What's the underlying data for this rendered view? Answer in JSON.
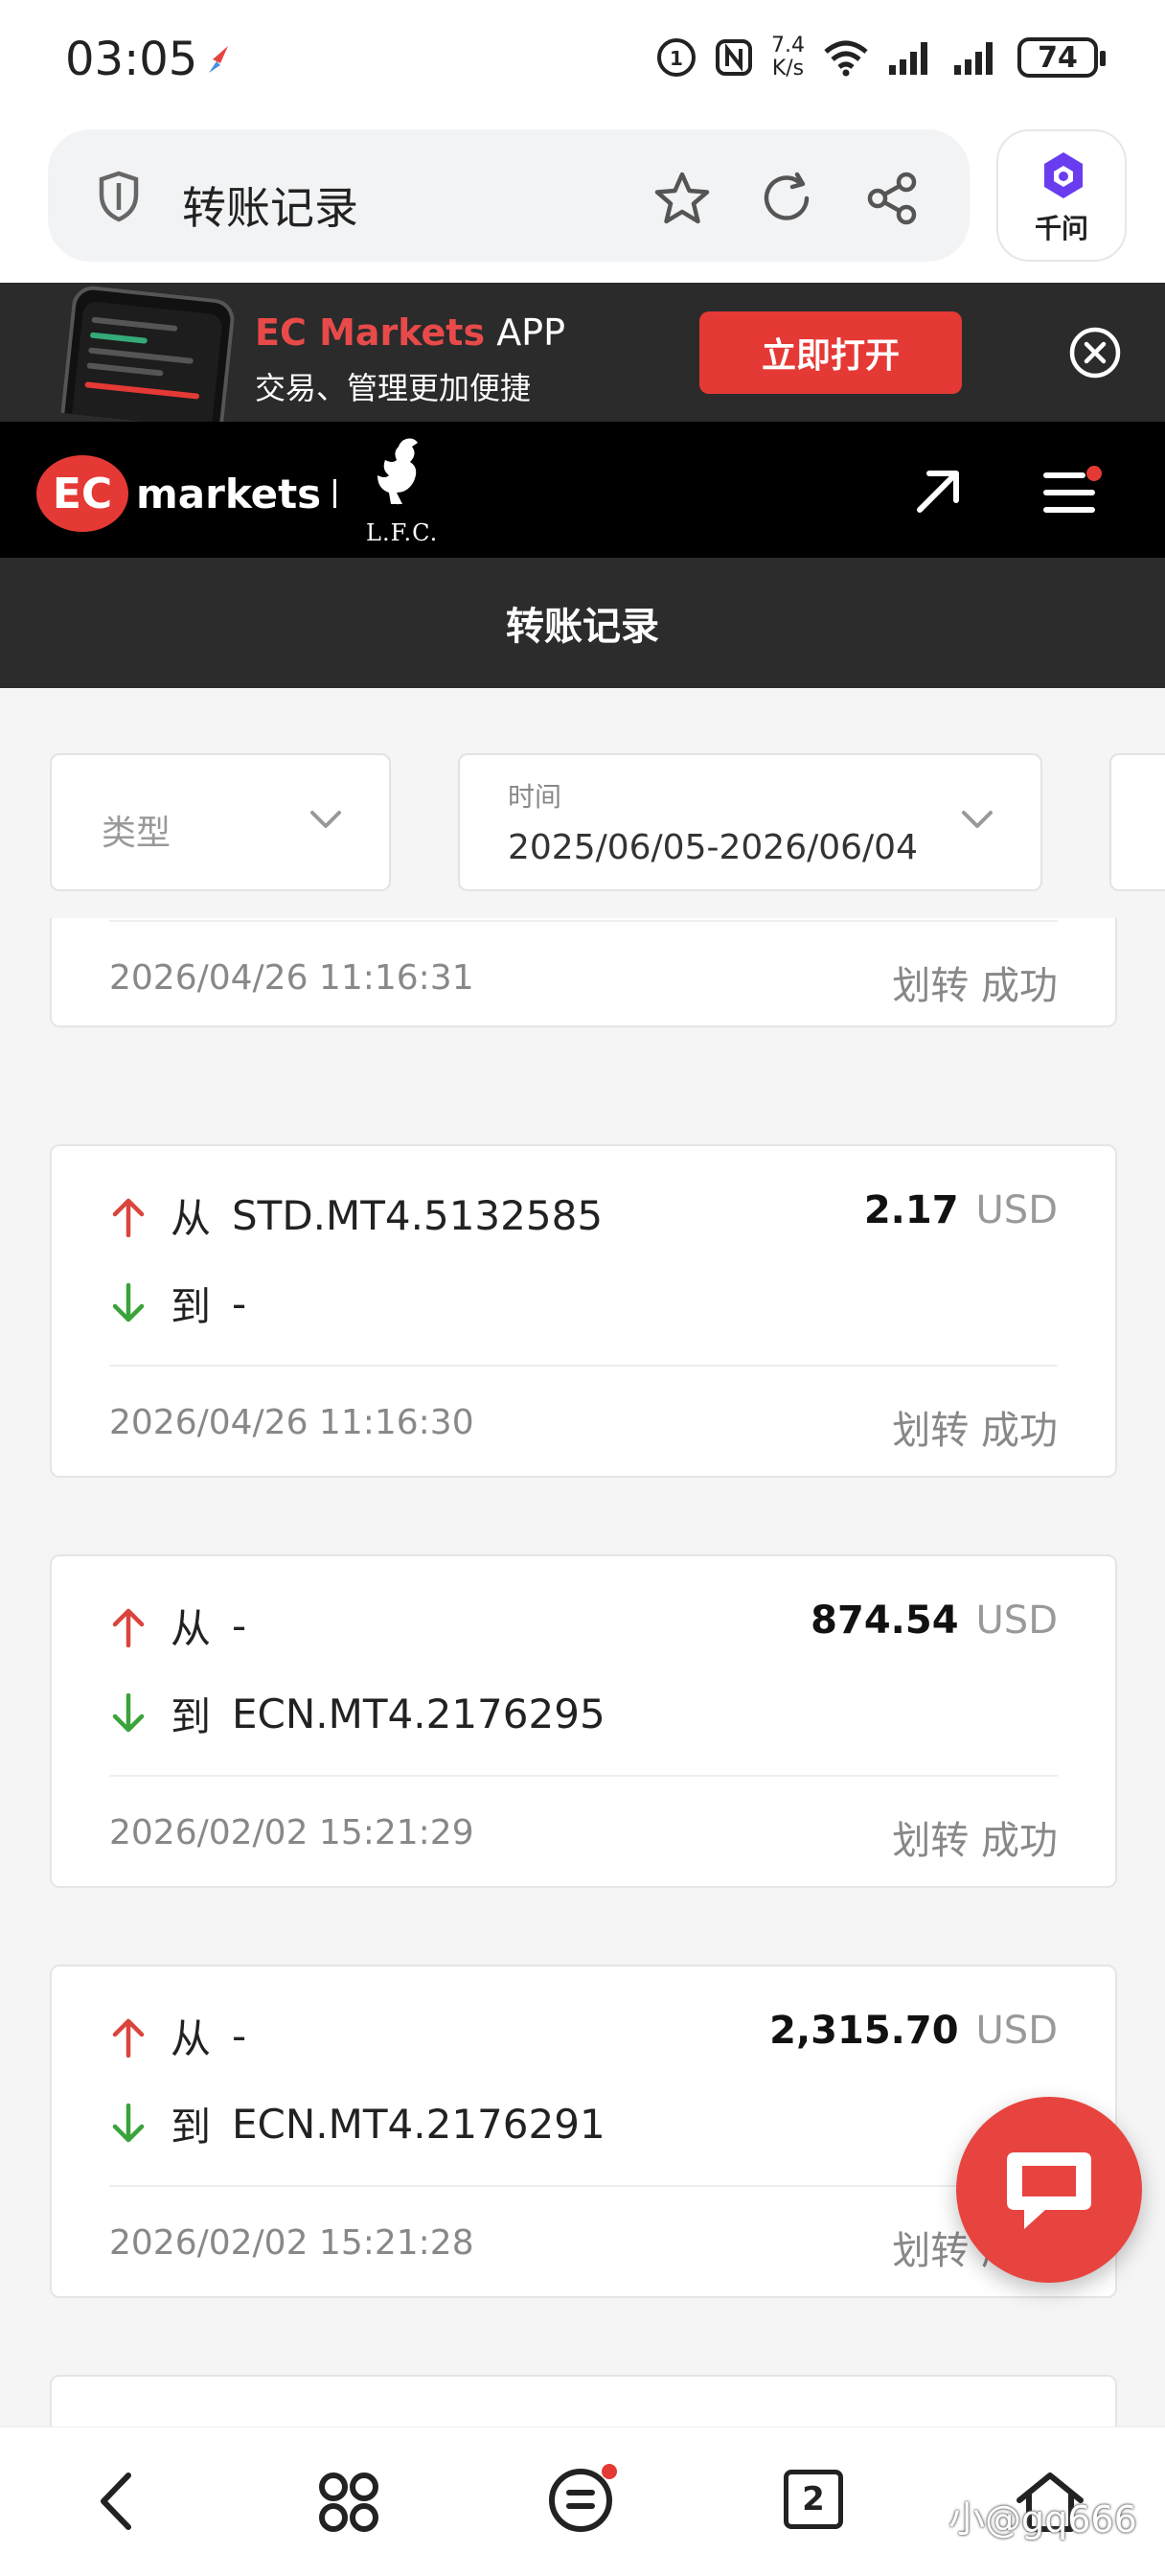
{
  "status_bar": {
    "time": "03:05",
    "net_speed_value": "7.4",
    "net_speed_unit": "K/s",
    "battery": "74"
  },
  "browser": {
    "title": "转账记录",
    "assistant_label": "千问"
  },
  "promo": {
    "brand": "EC Markets",
    "suffix": "APP",
    "subtitle": "交易、管理更加便捷",
    "open_button": "立即打开"
  },
  "header": {
    "logo_text": "markets",
    "logo_mark": "EC",
    "partner_text": "L.F.C."
  },
  "page": {
    "title": "转账记录"
  },
  "filters": {
    "type_placeholder": "类型",
    "time_label": "时间",
    "time_value": "2025/06/05-2026/06/04"
  },
  "labels": {
    "from": "从",
    "to": "到"
  },
  "records": [
    {
      "time": "2026/04/26 11:16:31",
      "status": "划转 成功"
    },
    {
      "from": "STD.MT4.5132585",
      "to": "-",
      "amount": "2.17",
      "currency": "USD",
      "time": "2026/04/26 11:16:30",
      "status": "划转 成功"
    },
    {
      "from": "-",
      "to": "ECN.MT4.2176295",
      "amount": "874.54",
      "currency": "USD",
      "time": "2026/02/02 15:21:29",
      "status": "划转 成功"
    },
    {
      "from": "-",
      "to": "ECN.MT4.2176291",
      "amount": "2,315.70",
      "currency": "USD",
      "time": "2026/02/02 15:21:28",
      "status": "划转 成功"
    }
  ],
  "bottom_nav": {
    "tab_count": "2"
  },
  "watermark": "小@gq666",
  "colors": {
    "accent_red": "#e53935",
    "up_arrow": "#d9453d",
    "down_arrow": "#3aa33a",
    "dark_bar": "#2c2c2c"
  },
  "icons": [
    "shield-icon",
    "star-icon",
    "refresh-icon",
    "share-icon",
    "close-icon",
    "arrow-up-right-icon",
    "menu-icon",
    "chevron-down-icon",
    "arrow-up-icon",
    "arrow-down-icon",
    "chat-icon",
    "back-icon",
    "apps-icon",
    "menu-circle-icon",
    "home-icon"
  ]
}
